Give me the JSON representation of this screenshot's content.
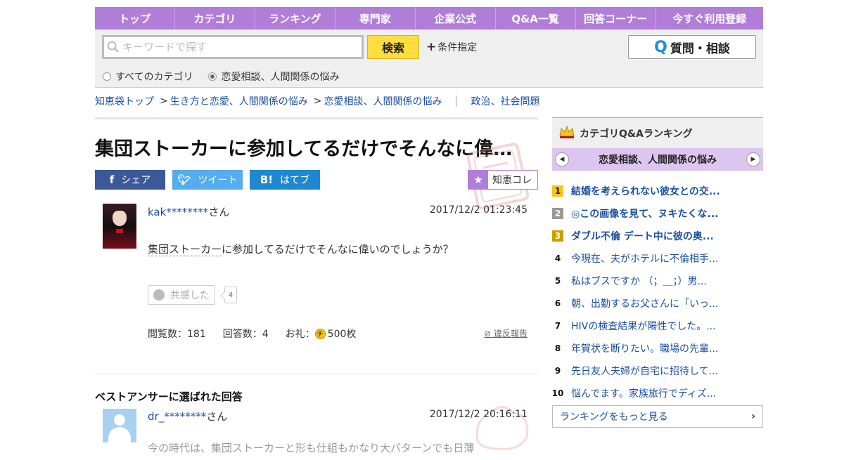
{
  "nav": [
    "トップ",
    "カテゴリ",
    "ランキング",
    "専門家",
    "企業公式",
    "Q&A一覧",
    "回答コーナー",
    "今すぐ利用登録"
  ],
  "search": {
    "placeholder": "キーワードで探す",
    "button": "検索",
    "condition": "条件指定",
    "ask_button": "質問・相談",
    "radio_all": "すべてのカテゴリ",
    "radio_cat": "恋愛相談、人間関係の悩み"
  },
  "breadcrumb": {
    "top": "知恵袋トップ",
    "b1": "生き方と恋愛、人間関係の悩み",
    "b2": "恋愛相談、人間関係の悩み",
    "sep": ">",
    "related": "政治、社会問題"
  },
  "question": {
    "title": "集団ストーカーに参加してるだけでそんなに偉…",
    "share_fb": "シェア",
    "share_tw": "ツイート",
    "share_hb": "はてブ",
    "chiecolle": "知恵コレ",
    "user": "kak********",
    "san": "さん",
    "date": "2017/12/2  01:23:45",
    "body_kw": "集団ストーカー",
    "body_rest": "に参加してるだけでそんなに偉いのでしょうか？",
    "empathy": "共感した",
    "empathy_count": "4",
    "views": "閲覧数：181",
    "answers": "回答数：4",
    "reward_label": "お礼：",
    "reward_value": "500枚",
    "report": "違反報告"
  },
  "best_answer": {
    "heading": "ベストアンサーに選ばれた回答",
    "user": "dr_********",
    "san": "さん",
    "date": "2017/12/2  20:16:11",
    "body": "今の時代は、集団ストーカーと形も仕組もかなり大パターンでも日薄"
  },
  "sidebar": {
    "title": "カテゴリQ&Aランキング",
    "category": "恋愛相談、人間関係の悩み",
    "rankings": [
      {
        "n": "1",
        "t": "結婚を考えられない彼女との交..."
      },
      {
        "n": "2",
        "t": "◎この画像を見て、ヌキたくな..."
      },
      {
        "n": "3",
        "t": "ダブル不倫 デート中に彼の奥..."
      },
      {
        "n": "4",
        "t": "今現在、夫がホテルに不倫相手..."
      },
      {
        "n": "5",
        "t": "私はブスですか （；＿；）男..."
      },
      {
        "n": "6",
        "t": "朝、出勤するお父さんに「いっ..."
      },
      {
        "n": "7",
        "t": "HIVの検査結果が陽性でした。..."
      },
      {
        "n": "8",
        "t": "年賀状を断りたい。職場の先輩..."
      },
      {
        "n": "9",
        "t": "先日友人夫婦が自宅に招待して..."
      },
      {
        "n": "10",
        "t": "悩んでます。家族旅行でディズ..."
      }
    ],
    "more": "ランキングをもっと見る"
  },
  "colors": {
    "accent": "#b07ed8",
    "link": "#1a4fa0",
    "search_button": "#ffdd3f"
  }
}
